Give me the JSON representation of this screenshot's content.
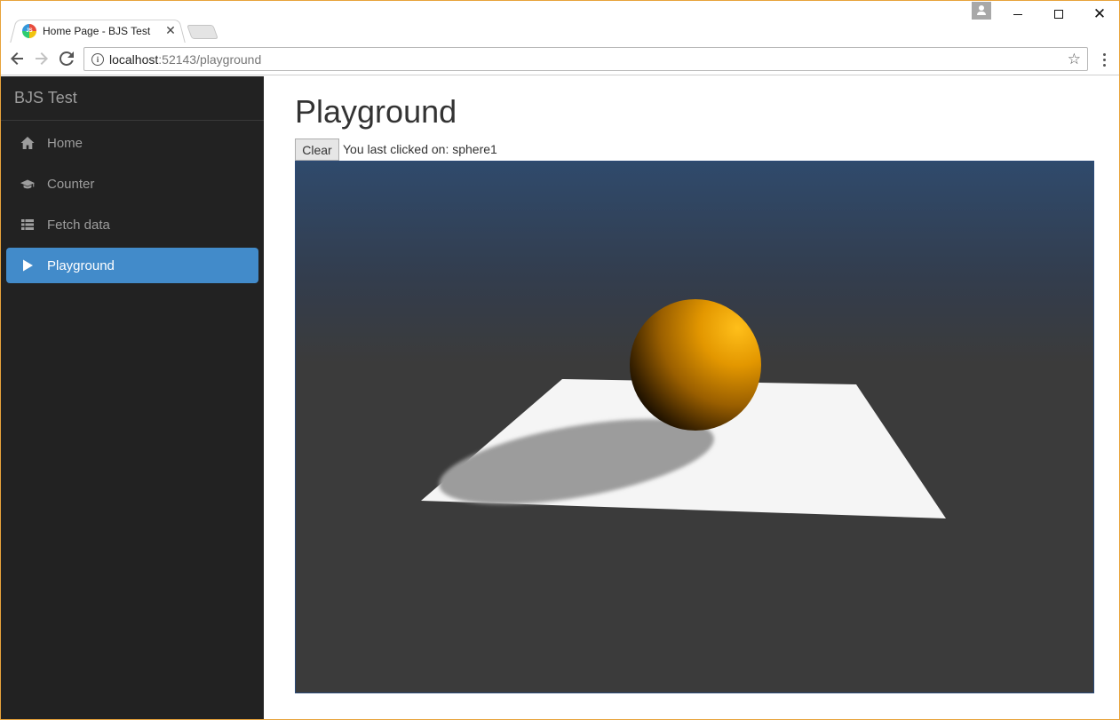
{
  "browser": {
    "tab_title": "Home Page - BJS Test",
    "favicon_text": "JS",
    "url_host": "localhost",
    "url_rest": ":52143/playground"
  },
  "sidebar": {
    "brand": "BJS Test",
    "items": [
      {
        "label": "Home",
        "icon": "home-icon",
        "active": false
      },
      {
        "label": "Counter",
        "icon": "graduation-cap-icon",
        "active": false
      },
      {
        "label": "Fetch data",
        "icon": "list-icon",
        "active": false
      },
      {
        "label": "Playground",
        "icon": "play-icon",
        "active": true
      }
    ]
  },
  "main": {
    "title": "Playground",
    "clear_label": "Clear",
    "last_clicked_text": "You last clicked on: sphere1"
  },
  "colors": {
    "sidebar_bg": "#222222",
    "active_item": "#428bca",
    "canvas_top": "#2f4a6c",
    "canvas_bottom": "#3b3b3b",
    "sphere": "#e8a000",
    "ground": "#f5f5f5"
  }
}
